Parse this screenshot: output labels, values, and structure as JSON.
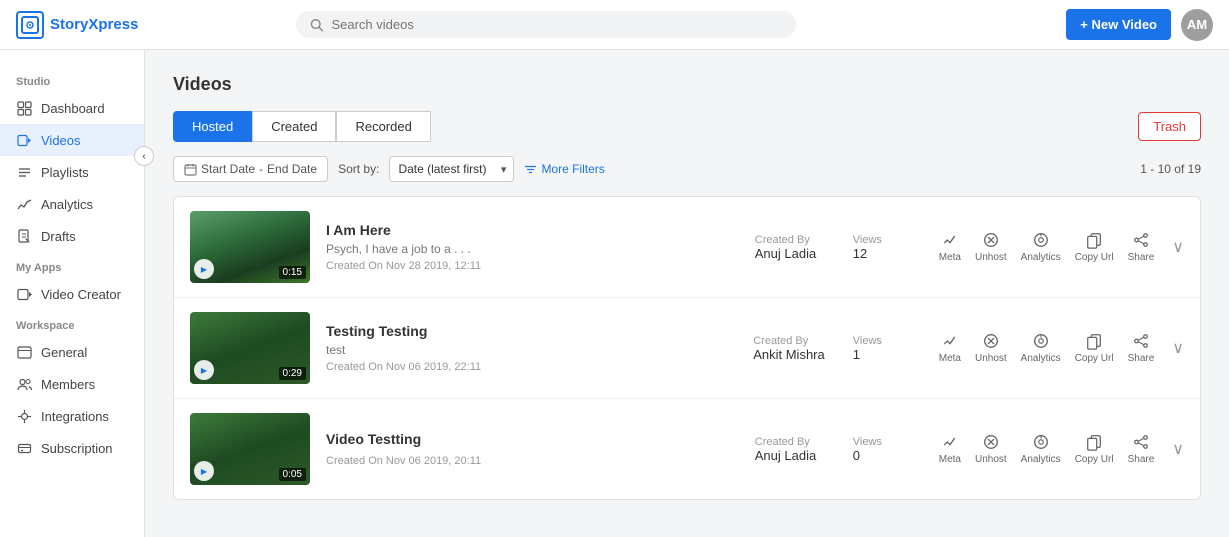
{
  "app": {
    "name": "StoryXpress",
    "logo_text": "[o]"
  },
  "topbar": {
    "search_placeholder": "Search videos",
    "new_video_label": "+ New Video",
    "avatar_initials": "AM"
  },
  "sidebar": {
    "sections": [
      {
        "label": "Studio",
        "items": [
          {
            "id": "dashboard",
            "label": "Dashboard",
            "icon": "⊞"
          },
          {
            "id": "videos",
            "label": "Videos",
            "icon": "▶",
            "active": true
          },
          {
            "id": "playlists",
            "label": "Playlists",
            "icon": "≡"
          },
          {
            "id": "analytics",
            "label": "Analytics",
            "icon": "∿"
          },
          {
            "id": "drafts",
            "label": "Drafts",
            "icon": "✎"
          }
        ]
      },
      {
        "label": "My Apps",
        "items": [
          {
            "id": "video-creator",
            "label": "Video Creator",
            "icon": "▣"
          }
        ]
      },
      {
        "label": "Workspace",
        "items": [
          {
            "id": "general",
            "label": "General",
            "icon": "⊟"
          },
          {
            "id": "members",
            "label": "Members",
            "icon": "⚙"
          },
          {
            "id": "integrations",
            "label": "Integrations",
            "icon": "⚙"
          },
          {
            "id": "subscription",
            "label": "Subscription",
            "icon": "⚙"
          }
        ]
      }
    ]
  },
  "main": {
    "page_title": "Videos",
    "tabs": [
      {
        "id": "hosted",
        "label": "Hosted",
        "active": true
      },
      {
        "id": "created",
        "label": "Created",
        "active": false
      },
      {
        "id": "recorded",
        "label": "Recorded",
        "active": false
      }
    ],
    "trash_label": "Trash",
    "filters": {
      "start_date_placeholder": "Start Date",
      "date_separator": "-",
      "end_date_placeholder": "End Date",
      "sort_by_label": "Sort by:",
      "sort_options": [
        {
          "value": "date_latest",
          "label": "Date (latest first)"
        }
      ],
      "sort_selected": "Date (latest first)",
      "more_filters_label": "More Filters",
      "pagination": "1 - 10 of 19"
    },
    "videos": [
      {
        "id": "v1",
        "title": "I Am Here",
        "description": "Psych, I have a job to a . . .",
        "created_on": "Created On Nov 28 2019, 12:11",
        "created_by_label": "Created By",
        "created_by": "Anuj Ladia",
        "views_label": "Views",
        "views": "12",
        "duration": "0:15",
        "thumb_class": "thumb-1",
        "actions": [
          "Meta",
          "Unhost",
          "Analytics",
          "Copy Url",
          "Share"
        ]
      },
      {
        "id": "v2",
        "title": "Testing Testing",
        "description": "test",
        "created_on": "Created On Nov 06 2019, 22:11",
        "created_by_label": "Created By",
        "created_by": "Ankit Mishra",
        "views_label": "Views",
        "views": "1",
        "duration": "0:29",
        "thumb_class": "thumb-2",
        "actions": [
          "Meta",
          "Unhost",
          "Analytics",
          "Copy Url",
          "Share"
        ]
      },
      {
        "id": "v3",
        "title": "Video Testting",
        "description": "",
        "created_on": "Created On Nov 06 2019, 20:11",
        "created_by_label": "Created By",
        "created_by": "Anuj Ladia",
        "views_label": "Views",
        "views": "0",
        "duration": "0:05",
        "thumb_class": "thumb-3",
        "actions": [
          "Meta",
          "Unhost",
          "Analytics",
          "Copy Url",
          "Share"
        ]
      }
    ]
  }
}
